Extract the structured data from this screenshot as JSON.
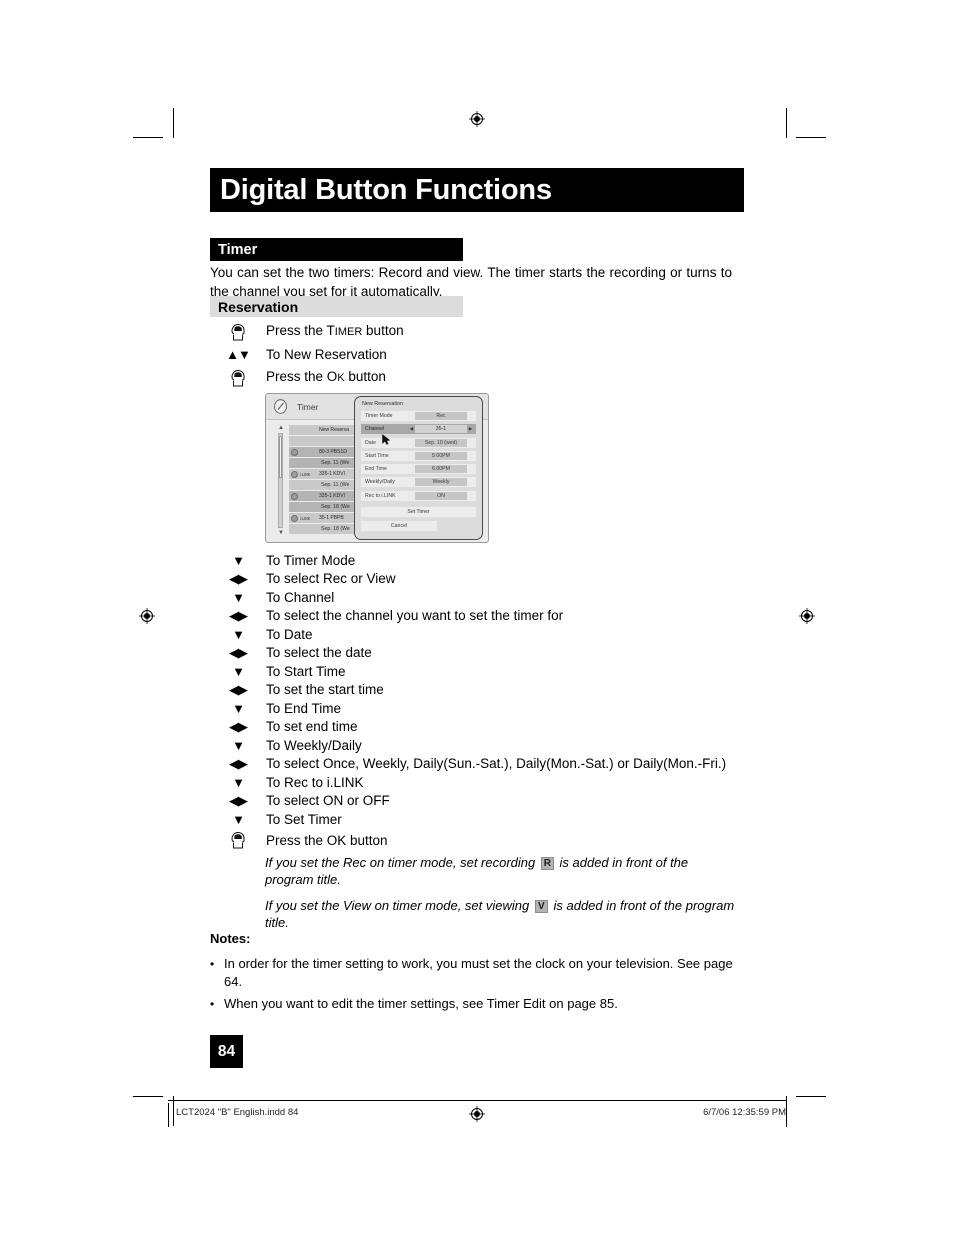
{
  "header": {
    "title": "Digital Button Functions"
  },
  "section": {
    "title": "Timer",
    "intro": "You can set the two timers:  Record and view.  The timer starts the recording or turns to the channel you set for it automatically.",
    "subsection_title": "Reservation"
  },
  "steps_top": [
    {
      "icon": "hand-press-icon",
      "text_prefix": "Press the ",
      "smallcaps": "T",
      "smallcaps_rest": "IMER",
      "text_suffix": " button",
      "full": "Press the TIMER button"
    },
    {
      "icon": "up-down-arrow-icon",
      "glyph": "▲▼",
      "full": "To New Reservation"
    },
    {
      "icon": "hand-press-icon",
      "text_prefix": "Press the ",
      "smallcaps": "O",
      "smallcaps_rest": "K",
      "text_suffix": " button",
      "full": "Press the OK button"
    }
  ],
  "steps_nav": [
    {
      "glyph": "▼",
      "icon": "down-arrow-icon",
      "label": "To Timer Mode"
    },
    {
      "glyph": "◀▶",
      "icon": "left-right-arrow-icon",
      "label": "To select Rec or View"
    },
    {
      "glyph": "▼",
      "icon": "down-arrow-icon",
      "label": "To Channel"
    },
    {
      "glyph": "◀▶",
      "icon": "left-right-arrow-icon",
      "label": "To select the channel you want to set the timer for"
    },
    {
      "glyph": "▼",
      "icon": "down-arrow-icon",
      "label": "To Date"
    },
    {
      "glyph": "◀▶",
      "icon": "left-right-arrow-icon",
      "label": "To select the date"
    },
    {
      "glyph": "▼",
      "icon": "down-arrow-icon",
      "label": "To Start Time"
    },
    {
      "glyph": "◀▶",
      "icon": "left-right-arrow-icon",
      "label": "To set the start time"
    },
    {
      "glyph": "▼",
      "icon": "down-arrow-icon",
      "label": "To End Time"
    },
    {
      "glyph": "◀▶",
      "icon": "left-right-arrow-icon",
      "label": "To set end time"
    },
    {
      "glyph": "▼",
      "icon": "down-arrow-icon",
      "label": "To Weekly/Daily"
    },
    {
      "glyph": "◀▶",
      "icon": "left-right-arrow-icon",
      "label": "To select Once, Weekly, Daily(Sun.-Sat.), Daily(Mon.-Sat.) or Daily(Mon.-Fri.)"
    },
    {
      "glyph": "▼",
      "icon": "down-arrow-icon",
      "label": "To Rec to i.LINK"
    },
    {
      "glyph": "◀▶",
      "icon": "left-right-arrow-icon",
      "label": "To select ON or OFF"
    },
    {
      "glyph": "▼",
      "icon": "down-arrow-icon",
      "label": "To Set Timer"
    },
    {
      "glyph": "",
      "icon": "hand-press-icon",
      "label": "Press the OK button"
    }
  ],
  "italic_notes": [
    {
      "before": "If you set the Rec on timer mode, set recording",
      "badge": "R",
      "after": "is added in front of the program title."
    },
    {
      "before": "If you set the View on timer mode, set viewing",
      "badge": "V",
      "after": "is added in front of the program title."
    }
  ],
  "notes": {
    "title": "Notes:",
    "bullet": "•",
    "items": [
      "In order for the timer setting to work, you must set the clock on your television.  See page 64.",
      "When you want to edit the timer settings, see Timer Edit on page 85."
    ]
  },
  "page_number": "84",
  "footer": {
    "left": "LCT2024 \"B\" English.indd   84",
    "right": "6/7/06   12:35:59 PM"
  },
  "osd": {
    "header_title": "Timer",
    "header_icon": "clock-icon",
    "scroll_up": "▲",
    "scroll_down": "▼",
    "list": [
      {
        "icon": "",
        "ilink": "",
        "title": "New Reserva",
        "sub": ""
      },
      {
        "icon": "clock-dot-icon",
        "ilink": "",
        "title": "80-3   PBS1D",
        "sub": "Sep. 11 (We"
      },
      {
        "icon": "clock-dot-icon",
        "ilink": "i.LINK",
        "title": "335-1   KDVI",
        "sub": "Sep. 11 (We"
      },
      {
        "icon": "clock-dot-icon",
        "ilink": "",
        "title": "335-1   KDVI",
        "sub": "Sep. 18 (We"
      },
      {
        "icon": "clock-dot-icon",
        "ilink": "i.LINK",
        "title": "35-1   PBPB",
        "sub": "Sep. 18 (We"
      }
    ],
    "dialog": {
      "title": "New Reservation",
      "fields": [
        {
          "label": "Timer Mode",
          "value": "Rec",
          "selected": false,
          "arrows": false
        },
        {
          "label": "Channel",
          "value": "35-1",
          "selected": true,
          "arrows": true
        },
        {
          "label": "Date",
          "value": "Sep. 10 (wed)",
          "selected": false,
          "arrows": false
        },
        {
          "label": "Start Time",
          "value": "5:00PM",
          "selected": false,
          "arrows": false
        },
        {
          "label": "End Time",
          "value": "6:00PM",
          "selected": false,
          "arrows": false
        },
        {
          "label": "Weekly/Daily",
          "value": "Weekly",
          "selected": false,
          "arrows": false
        },
        {
          "label": "Rec to i.LINK",
          "value": "ON",
          "selected": false,
          "arrows": false
        }
      ],
      "set_button": "Set Timer",
      "cancel_button": "Cancel",
      "left_caret": "◀",
      "right_caret": "▶"
    }
  },
  "colors": {
    "banner_bg": "#000000",
    "subsection_bg": "#dcdcdc",
    "badge_bg": "#b3b3b3",
    "osd_bg": "#ebebeb",
    "osd_selected": "#a8a8a8"
  }
}
